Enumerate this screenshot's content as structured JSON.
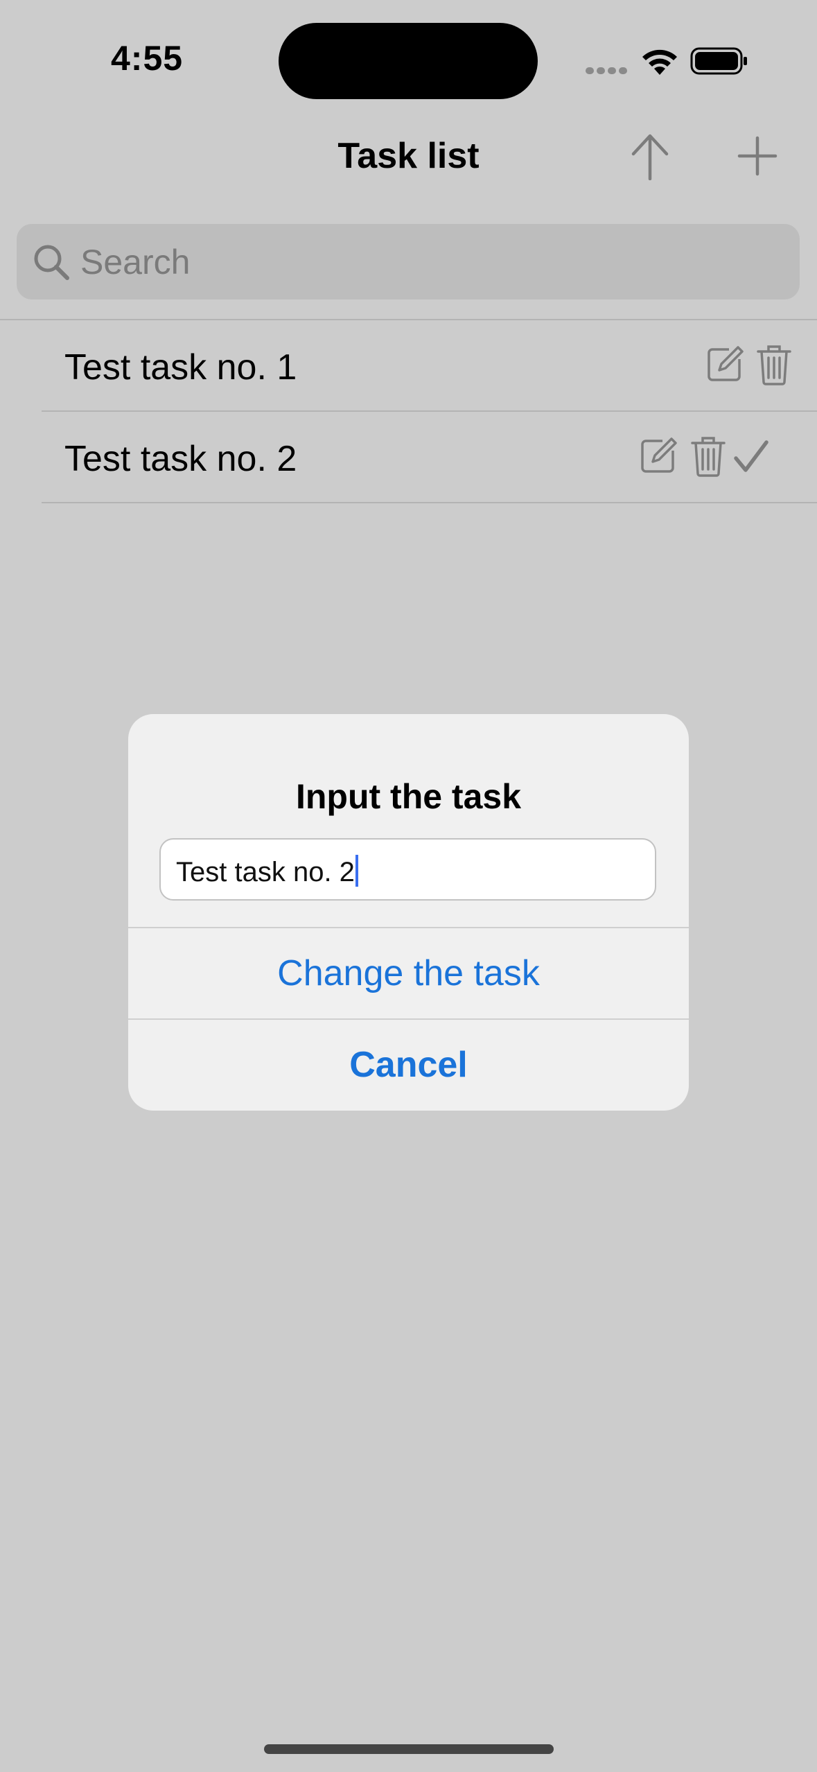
{
  "status_bar": {
    "time": "4:55",
    "icons": [
      "cellular-signal-icon",
      "wifi-icon",
      "battery-icon"
    ]
  },
  "nav_bar": {
    "title": "Task list",
    "actions": [
      "arrow-up-icon",
      "plus-icon"
    ]
  },
  "search": {
    "placeholder": "Search",
    "icon": "magnifying-glass-icon"
  },
  "tasks": [
    {
      "label": "Test task no. 1",
      "actions": [
        "edit-icon",
        "trash-icon"
      ]
    },
    {
      "label": "Test task no. 2",
      "actions": [
        "edit-icon",
        "trash-icon",
        "checkmark-icon"
      ]
    }
  ],
  "alert": {
    "title": "Input the task",
    "field_value": "Test task no. 2",
    "primary_button": "Change the task",
    "cancel_button": "Cancel"
  },
  "colors": {
    "background": "#cccccc",
    "accent": "#1a73d9",
    "icon_gray": "#7c7c7c"
  }
}
